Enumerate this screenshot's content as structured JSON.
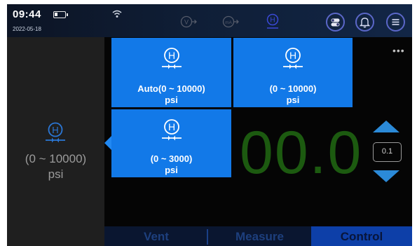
{
  "status_bar": {
    "time": "09:44",
    "date": "2022-05-18",
    "icons": [
      "battery-icon",
      "wifi-icon",
      "voltage-mode-icon",
      "ma-mode-icon",
      "hart-mode-icon",
      "switch-icon",
      "bell-icon",
      "menu-icon"
    ]
  },
  "left_panel": {
    "icon": "pressure-h-icon",
    "range": "(0 ~ 10000)",
    "unit": "psi"
  },
  "range_tiles": [
    {
      "range": "Auto(0 ~ 10000)",
      "unit": "psi"
    },
    {
      "range": "(0 ~ 10000)",
      "unit": "psi"
    },
    {
      "range": "(0 ~ 3000)",
      "unit": "psi"
    }
  ],
  "display": {
    "value": "00.0",
    "step": "0.1",
    "more": "•••"
  },
  "tabs": [
    {
      "label": "Vent",
      "active": false
    },
    {
      "label": "Measure",
      "active": false
    },
    {
      "label": "Control",
      "active": true
    }
  ],
  "colors": {
    "tile": "#1279e8",
    "value": "#1c5a10",
    "accent": "#2b8ad8"
  }
}
